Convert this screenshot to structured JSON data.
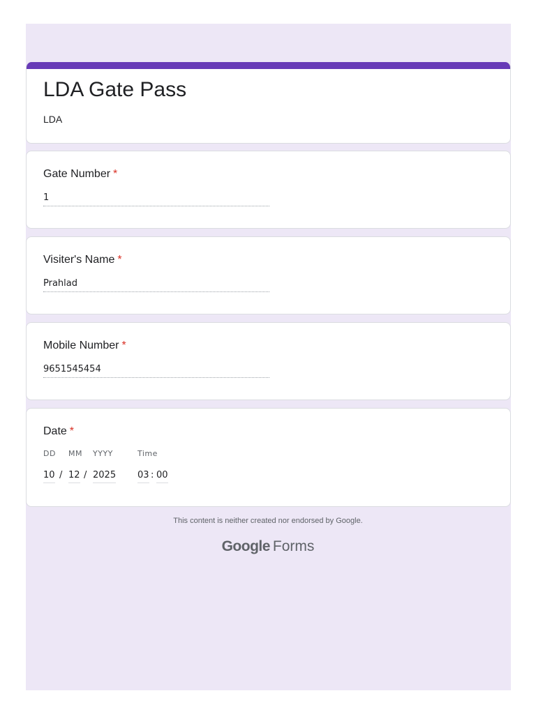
{
  "form": {
    "title": "LDA Gate Pass",
    "description": "LDA",
    "accent_color": "#673ab7",
    "background_color": "#ede7f6"
  },
  "questions": [
    {
      "label": "Gate Number",
      "required_mark": "*",
      "value": "1"
    },
    {
      "label": "Visiter's Name",
      "required_mark": "*",
      "value": "Prahlad"
    },
    {
      "label": "Mobile Number",
      "required_mark": "*",
      "value": "9651545454"
    }
  ],
  "date_question": {
    "label": "Date",
    "required_mark": "*",
    "dd_label": "DD",
    "mm_label": "MM",
    "yyyy_label": "YYYY",
    "time_label": "Time",
    "dd": "10",
    "mm": "12",
    "yyyy": "2025",
    "hour": "03",
    "minute": "00",
    "date_sep": "/",
    "time_sep": ":"
  },
  "footer": {
    "note": "This content is neither created nor endorsed by Google.",
    "brand_google": "Google",
    "brand_forms": "Forms"
  }
}
